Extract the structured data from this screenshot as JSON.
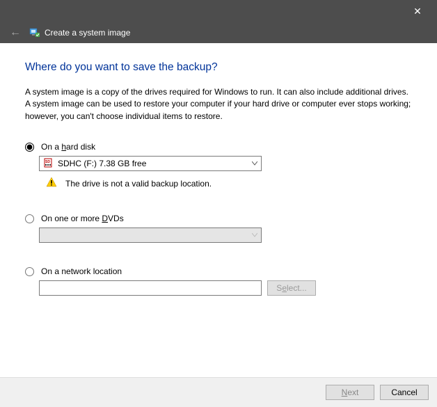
{
  "header": {
    "title": "Create a system image",
    "close_glyph": "✕",
    "back_glyph": "←"
  },
  "page_heading": "Where do you want to save the backup?",
  "description": "A system image is a copy of the drives required for Windows to run. It can also include additional drives. A system image can be used to restore your computer if your hard drive or computer ever stops working; however, you can't choose individual items to restore.",
  "options": {
    "hard_disk": {
      "label_pre": "On a ",
      "label_u": "h",
      "label_post": "ard disk",
      "selected_drive": "SDHC (F:)  7.38 GB free",
      "warning": "The drive is not a valid backup location."
    },
    "dvds": {
      "label_pre": "On one or more ",
      "label_u": "D",
      "label_post": "VDs"
    },
    "network": {
      "label": "On a network location",
      "input_value": "",
      "select_btn_pre": "S",
      "select_btn_u": "e",
      "select_btn_post": "lect..."
    }
  },
  "footer": {
    "next_u": "N",
    "next_post": "ext",
    "cancel": "Cancel"
  }
}
